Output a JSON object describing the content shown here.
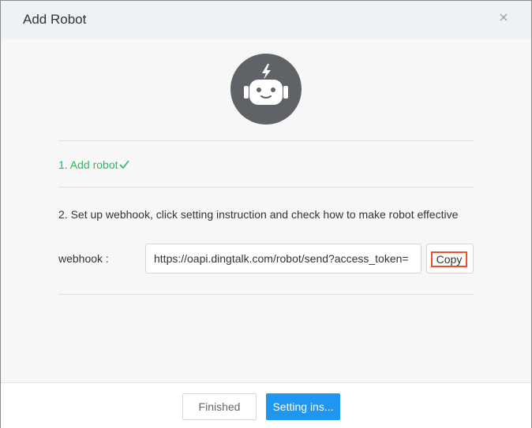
{
  "dialog": {
    "title": "Add Robot",
    "close_icon": "close-icon"
  },
  "robot_avatar": {
    "icon": "robot-icon",
    "color": "#5f6266"
  },
  "steps": {
    "step1_label": "1. Add robot",
    "step1_icon": "check-icon",
    "step1_color": "#2ab85a",
    "step2_label": "2. Set up webhook, click setting instruction and check how to make robot effective"
  },
  "webhook": {
    "label": "webhook :",
    "value": "https://oapi.dingtalk.com/robot/send?access_token=",
    "copy_label": "Copy"
  },
  "footer": {
    "finished_label": "Finished",
    "setting_label": "Setting ins...",
    "primary_color": "#1f96f0"
  }
}
